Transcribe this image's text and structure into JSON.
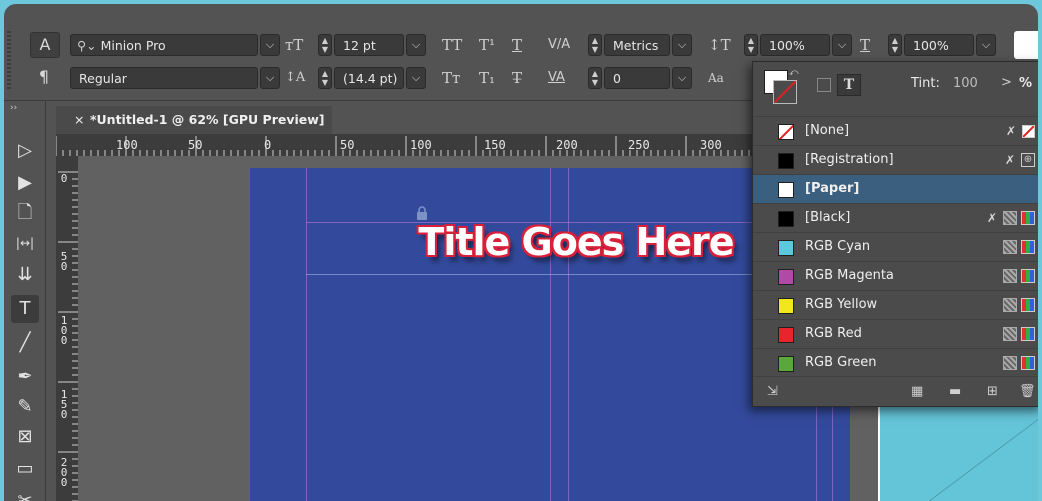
{
  "colors": {
    "page": "#334a9c",
    "accent_blue": "#6ec8dc",
    "title_outline": "#d8203a",
    "selection": "#3b5f7f"
  },
  "control_panel": {
    "mode_char": "A",
    "mode_para": "¶",
    "font_family": "Minion Pro",
    "font_style": "Regular",
    "font_size": "12 pt",
    "leading": "(14.4 pt)",
    "kerning": "Metrics",
    "tracking": "0",
    "vertical_scale": "100%",
    "horizontal_scale": "100%",
    "caps_glyphs": [
      "TT",
      "T¹",
      "T",
      "Tт",
      "T₁",
      "T̶"
    ]
  },
  "tools": [
    {
      "name": "selection-tool-icon",
      "glyph": "▷"
    },
    {
      "name": "direct-selection-tool-icon",
      "glyph": "▶"
    },
    {
      "name": "page-tool-icon",
      "glyph": "🗋"
    },
    {
      "name": "gap-tool-icon",
      "glyph": "|↔|"
    },
    {
      "name": "content-collector-tool-icon",
      "glyph": "⇊"
    },
    {
      "name": "type-tool-icon",
      "glyph": "T"
    },
    {
      "name": "line-tool-icon",
      "glyph": "╱"
    },
    {
      "name": "pen-tool-icon",
      "glyph": "✒"
    },
    {
      "name": "pencil-tool-icon",
      "glyph": "✎"
    },
    {
      "name": "rectangle-frame-tool-icon",
      "glyph": "⊠"
    },
    {
      "name": "rectangle-tool-icon",
      "glyph": "▭"
    },
    {
      "name": "scissors-tool-icon",
      "glyph": "✂"
    }
  ],
  "document": {
    "tab_close": "×",
    "tab_title": "*Untitled-1 @ 62% [GPU Preview]",
    "ruler_h_labels": [
      "100",
      "50",
      "0",
      "50",
      "100",
      "150",
      "200",
      "250",
      "300"
    ],
    "ruler_v_labels": [
      "0",
      "5\n0",
      "1\n0\n0",
      "1\n5\n0",
      "2\n0\n0"
    ],
    "page_title": "Title Goes Here"
  },
  "swatches_panel": {
    "format_t": "T",
    "tint_label": "Tint:",
    "tint_value": "100",
    "tint_arrow": ">",
    "tint_unit": "%",
    "items": [
      {
        "name": "[None]",
        "chip": "none",
        "icons": [
          "noedit",
          "none"
        ]
      },
      {
        "name": "[Registration]",
        "chip": "#000000",
        "icons": [
          "noedit",
          "reg"
        ]
      },
      {
        "name": "[Paper]",
        "chip": "#ffffff",
        "icons": [],
        "selected": true
      },
      {
        "name": "[Black]",
        "chip": "#000000",
        "icons": [
          "noedit",
          "cmyk",
          "rgb"
        ]
      },
      {
        "name": "RGB Cyan",
        "chip": "#5bc8dc",
        "icons": [
          "cmyk",
          "rgb"
        ]
      },
      {
        "name": "RGB Magenta",
        "chip": "#b04aa6",
        "icons": [
          "cmyk",
          "rgb"
        ]
      },
      {
        "name": "RGB Yellow",
        "chip": "#f0e81a",
        "icons": [
          "cmyk",
          "rgb"
        ]
      },
      {
        "name": "RGB Red",
        "chip": "#e8242c",
        "icons": [
          "cmyk",
          "rgb"
        ]
      },
      {
        "name": "RGB Green",
        "chip": "#5aa83c",
        "icons": [
          "cmyk",
          "rgb"
        ]
      }
    ]
  }
}
